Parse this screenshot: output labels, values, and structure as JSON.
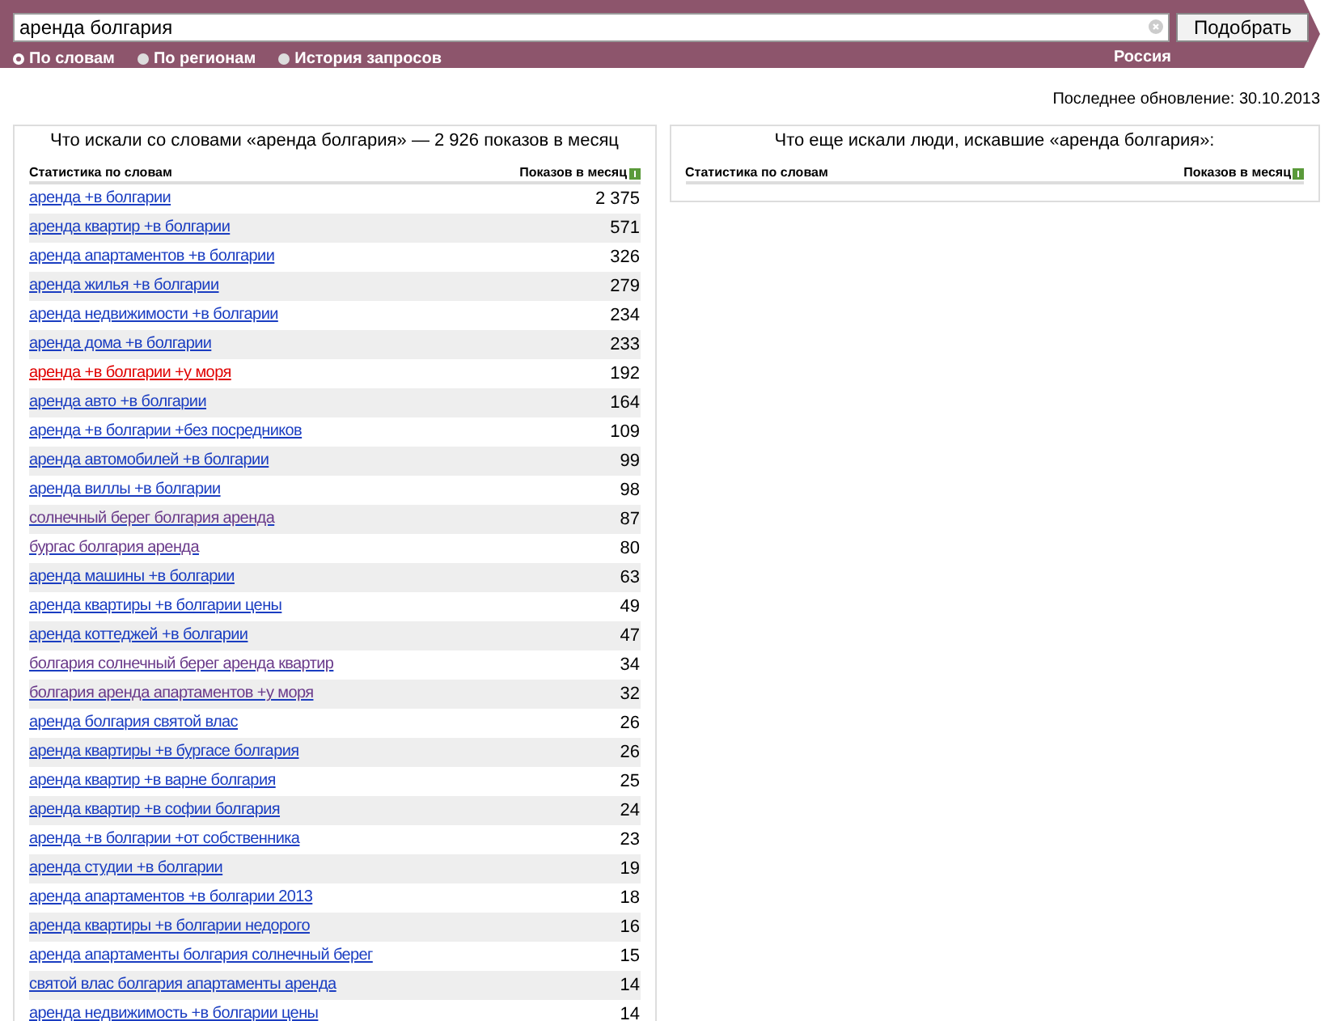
{
  "search": {
    "value": "аренда болгария",
    "button": "Подобрать"
  },
  "modes": [
    {
      "label": "По словам",
      "selected": true
    },
    {
      "label": "По регионам",
      "selected": false
    },
    {
      "label": "История запросов",
      "selected": false
    }
  ],
  "region": "Россия",
  "last_update": "Последнее обновление: 30.10.2013",
  "left_panel": {
    "title": "Что искали со словами «аренда болгария» — 2 926 показов в месяц",
    "columns": [
      "Статистика по словам",
      "Показов в месяц"
    ],
    "rows": [
      {
        "phrase": "аренда +в болгарии",
        "count": "2 375",
        "kind": "link"
      },
      {
        "phrase": "аренда квартир +в болгарии",
        "count": "571",
        "kind": "link"
      },
      {
        "phrase": "аренда апартаментов +в болгарии",
        "count": "326",
        "kind": "link"
      },
      {
        "phrase": "аренда жилья +в болгарии",
        "count": "279",
        "kind": "link"
      },
      {
        "phrase": "аренда недвижимости +в болгарии",
        "count": "234",
        "kind": "link"
      },
      {
        "phrase": "аренда дома +в болгарии",
        "count": "233",
        "kind": "link"
      },
      {
        "phrase": "аренда +в болгарии +у моря",
        "count": "192",
        "kind": "hover"
      },
      {
        "phrase": "аренда авто +в болгарии",
        "count": "164",
        "kind": "link"
      },
      {
        "phrase": "аренда +в болгарии +без посредников",
        "count": "109",
        "kind": "link"
      },
      {
        "phrase": "аренда автомобилей +в болгарии",
        "count": "99",
        "kind": "link"
      },
      {
        "phrase": "аренда виллы +в болгарии",
        "count": "98",
        "kind": "link"
      },
      {
        "phrase": "солнечный берег болгария аренда",
        "count": "87",
        "kind": "visited"
      },
      {
        "phrase": "бургас болгария аренда",
        "count": "80",
        "kind": "visited"
      },
      {
        "phrase": "аренда машины +в болгарии",
        "count": "63",
        "kind": "link"
      },
      {
        "phrase": "аренда квартиры +в болгарии цены",
        "count": "49",
        "kind": "link"
      },
      {
        "phrase": "аренда коттеджей +в болгарии",
        "count": "47",
        "kind": "link"
      },
      {
        "phrase": "болгария солнечный берег аренда квартир",
        "count": "34",
        "kind": "visited"
      },
      {
        "phrase": "болгария аренда апартаментов +у моря",
        "count": "32",
        "kind": "visited"
      },
      {
        "phrase": "аренда болгария святой влас",
        "count": "26",
        "kind": "link"
      },
      {
        "phrase": "аренда квартиры +в бургасе болгария",
        "count": "26",
        "kind": "link"
      },
      {
        "phrase": "аренда квартир +в варне болгария",
        "count": "25",
        "kind": "link"
      },
      {
        "phrase": "аренда квартир +в софии болгария",
        "count": "24",
        "kind": "link"
      },
      {
        "phrase": "аренда +в болгарии +от собственника",
        "count": "23",
        "kind": "link"
      },
      {
        "phrase": "аренда студии +в болгарии",
        "count": "19",
        "kind": "link"
      },
      {
        "phrase": "аренда апартаментов +в болгарии 2013",
        "count": "18",
        "kind": "link"
      },
      {
        "phrase": "аренда квартиры +в болгарии недорого",
        "count": "16",
        "kind": "link"
      },
      {
        "phrase": "аренда апартаменты болгария солнечный берег",
        "count": "15",
        "kind": "link"
      },
      {
        "phrase": "святой влас болгария апартаменты аренда",
        "count": "14",
        "kind": "link"
      },
      {
        "phrase": "аренда недвижимость +в болгарии цены",
        "count": "14",
        "kind": "link"
      }
    ]
  },
  "right_panel": {
    "title": "Что еще искали люди, искавшие «аренда болгария»:",
    "columns": [
      "Статистика по словам",
      "Показов в месяц"
    ]
  }
}
